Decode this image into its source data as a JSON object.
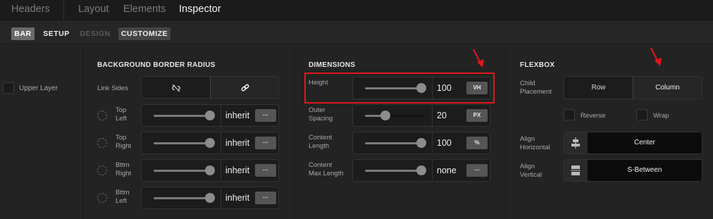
{
  "topnav": {
    "tabs": [
      "Headers",
      "Layout",
      "Elements",
      "Inspector"
    ],
    "active": "Inspector"
  },
  "subnav": {
    "bar": "BAR",
    "setup": "SETUP",
    "design": "DESIGN",
    "customize": "CUSTOMIZE"
  },
  "layer": {
    "label": "Upper Layer"
  },
  "radius": {
    "heading": "BACKGROUND BORDER RADIUS",
    "link_sides": "Link Sides",
    "rows": [
      {
        "label": "Top\nLeft",
        "value": "inherit",
        "unit": "···",
        "fill": 0.95
      },
      {
        "label": "Top\nRight",
        "value": "inherit",
        "unit": "···",
        "fill": 0.95
      },
      {
        "label": "Bttm\nRight",
        "value": "inherit",
        "unit": "···",
        "fill": 0.95
      },
      {
        "label": "Bttm\nLeft",
        "value": "inherit",
        "unit": "···",
        "fill": 0.95
      }
    ]
  },
  "dimensions": {
    "heading": "DIMENSIONS",
    "rows": [
      {
        "label": "Height",
        "value": "100",
        "unit": "VH",
        "fill": 0.95
      },
      {
        "label": "Outer\nSpacing",
        "value": "20",
        "unit": "PX",
        "fill": 0.35
      },
      {
        "label": "Content\nLength",
        "value": "100",
        "unit": "%",
        "fill": 0.95
      },
      {
        "label": "Content\nMax Length",
        "value": "none",
        "unit": "···",
        "fill": 0.95
      }
    ]
  },
  "flexbox": {
    "heading": "FLEXBOX",
    "child_placement": {
      "label": "Child\nPlacement",
      "options": [
        "Row",
        "Column"
      ],
      "selected": "Column"
    },
    "reverse": "Reverse",
    "wrap": "Wrap",
    "align_horizontal": {
      "label": "Align\nHorizontal",
      "value": "Center"
    },
    "align_vertical": {
      "label": "Align\nVertical",
      "value": "S-Between"
    }
  },
  "colors": {
    "annotation": "#e0161c"
  }
}
